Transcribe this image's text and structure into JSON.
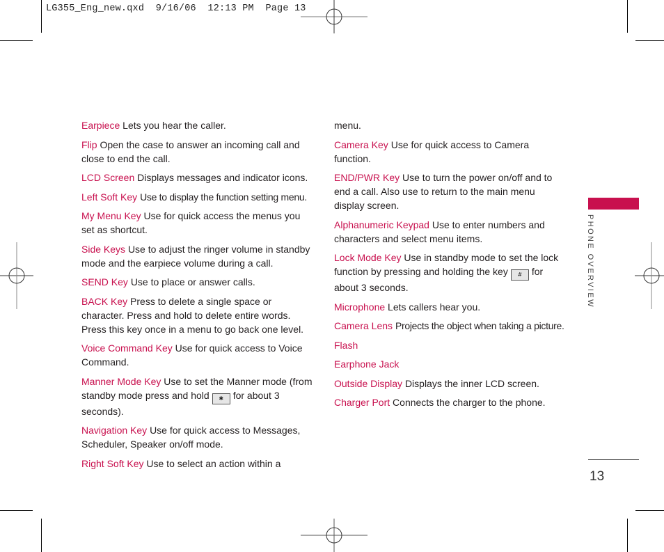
{
  "slug": "LG355_Eng_new.qxd  9/16/06  12:13 PM  Page 13",
  "section_label": "PHONE OVERVIEW",
  "page_number": "13",
  "colors": {
    "accent": "#c8104e",
    "text": "#231f20"
  },
  "left_column": [
    {
      "term": "Earpiece",
      "desc": "Lets you hear the caller."
    },
    {
      "term": "Flip",
      "desc": "Open the case to answer an incoming call and close to end the call."
    },
    {
      "term": "LCD Screen",
      "desc": "Displays messages and indicator icons."
    },
    {
      "term": "Left Soft Key",
      "desc": "Use to display the function setting menu."
    },
    {
      "term": "My Menu Key",
      "desc": "Use for quick access the menus you set as shortcut."
    },
    {
      "term": "Side Keys",
      "desc": "Use to adjust the ringer volume in standby mode and the earpiece volume during a call."
    },
    {
      "term": "SEND Key",
      "desc": "Use to place or answer calls."
    },
    {
      "term": "BACK Key",
      "desc": "Press to delete a single space or character. Press and hold to delete entire words. Press this key once in a menu to go back one level."
    },
    {
      "term": "Voice Command Key",
      "desc": "Use for quick access to Voice Command."
    },
    {
      "term": "Manner Mode Key",
      "desc_before": "Use to set the Manner mode (from standby mode press and hold",
      "icon": "star-key-icon",
      "icon_text": "✱",
      "desc_after": "for about 3 seconds)."
    },
    {
      "term": "Navigation Key",
      "desc": "Use for quick access to Messages, Scheduler, Speaker on/off mode."
    },
    {
      "term": "Right Soft Key",
      "desc": "Use to select an action within a"
    }
  ],
  "right_column_continuation": "menu.",
  "right_column": [
    {
      "term": "Camera Key",
      "desc": "Use for quick access to Camera function."
    },
    {
      "term": "END/PWR Key",
      "desc": "Use to turn the power on/off and to end a call. Also use to return to the main menu display screen."
    },
    {
      "term": "Alphanumeric Keypad",
      "desc": "Use to enter numbers and characters and select menu items."
    },
    {
      "term": "Lock Mode Key",
      "desc_before": "Use in standby mode to set the lock function by pressing and holding the key",
      "icon": "pound-key-icon",
      "icon_text": "#",
      "desc_after": "for about 3 seconds."
    },
    {
      "term": "Microphone",
      "desc": "Lets callers hear you."
    },
    {
      "term": "Camera Lens",
      "desc": "Projects the object when taking a picture."
    },
    {
      "term": "Flash",
      "desc": ""
    },
    {
      "term": "Earphone Jack",
      "desc": ""
    },
    {
      "term": "Outside Display",
      "desc": "Displays the inner LCD screen."
    },
    {
      "term": "Charger Port",
      "desc": "Connects the charger to the phone."
    }
  ]
}
